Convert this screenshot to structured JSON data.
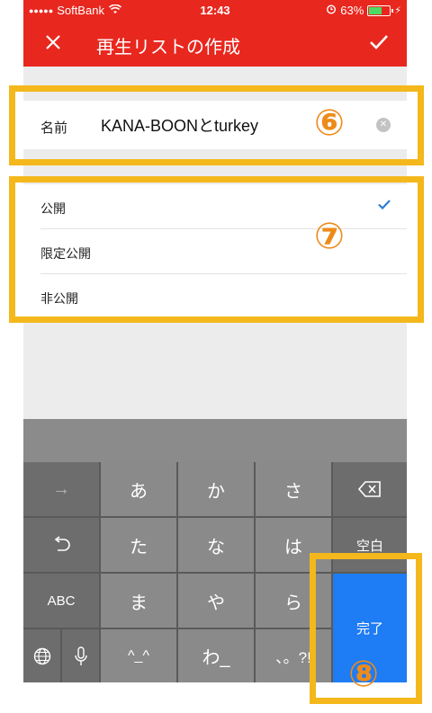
{
  "status_bar": {
    "carrier": "SoftBank",
    "time": "12:43",
    "battery_percent": "63%",
    "battery_level": 0.63
  },
  "app_bar": {
    "title": "再生リストの作成"
  },
  "form": {
    "name_label": "名前",
    "name_value": "KANA-BOONとturkey"
  },
  "privacy_options": [
    {
      "label": "公開",
      "selected": true
    },
    {
      "label": "限定公開",
      "selected": false
    },
    {
      "label": "非公開",
      "selected": false
    }
  ],
  "keyboard": {
    "keys": {
      "arrow": "→",
      "a": "あ",
      "ka": "か",
      "sa": "さ",
      "undo": "↺",
      "ta": "た",
      "na": "な",
      "ha": "は",
      "space": "空白",
      "abc": "ABC",
      "ma": "ま",
      "ya": "や",
      "ra": "ら",
      "done": "完了",
      "kaomoji": "^_^",
      "wa": "わ_",
      "punct": "、。?!"
    }
  },
  "annotations": [
    "⑥",
    "⑦",
    "⑧"
  ],
  "colors": {
    "brand_red": "#e8271e",
    "annotation_yellow": "#f4b81c",
    "annotation_orange": "#ed8b1a",
    "done_blue": "#1e7cf4",
    "check_blue": "#2a7fd4"
  }
}
